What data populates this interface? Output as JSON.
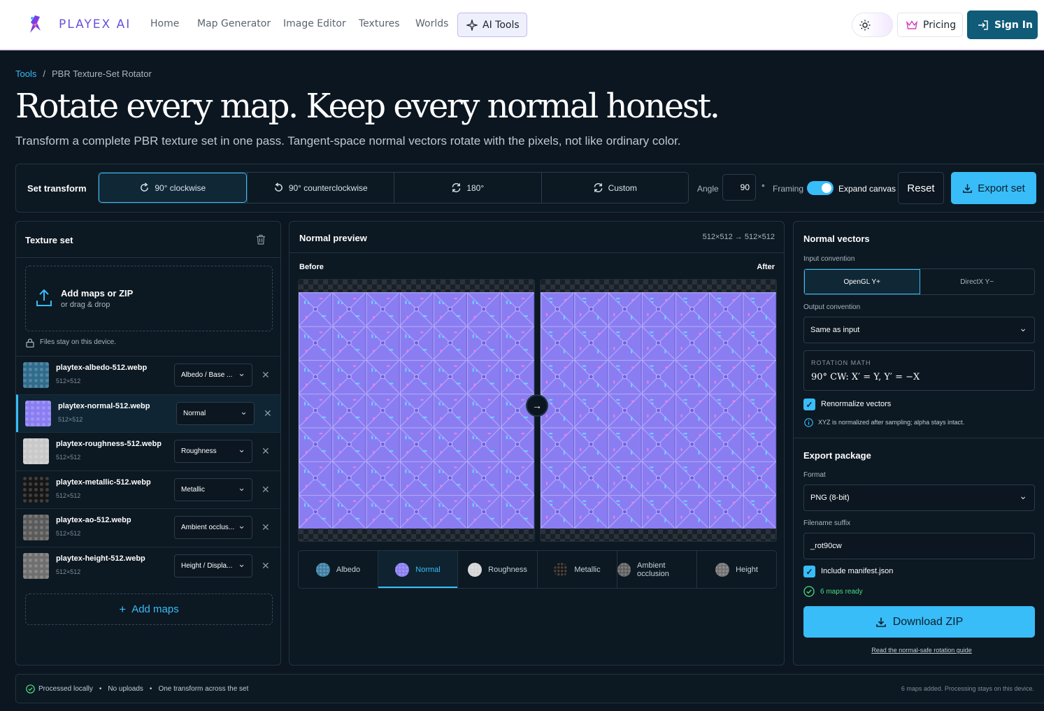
{
  "brand": {
    "name": "PLAYEX AI"
  },
  "nav": [
    "Home",
    "Map Generator",
    "Image Editor",
    "Textures",
    "Worlds"
  ],
  "header": {
    "ai_tools": "AI Tools",
    "pricing": "Pricing",
    "sign_in": "Sign In"
  },
  "breadcrumb": {
    "root": "Tools",
    "sep": "/",
    "current": "PBR Texture-Set Rotator"
  },
  "hero": {
    "title": "Rotate every map. Keep every normal honest.",
    "subtitle": "Transform a complete PBR texture set in one pass. Tangent-space normal vectors rotate with the pixels, not like ordinary color."
  },
  "toolbar": {
    "label": "Set transform",
    "options": [
      "90° clockwise",
      "90° counterclockwise",
      "180°",
      "Custom"
    ],
    "selected": "90° clockwise",
    "angle_label": "Angle",
    "angle_value": "90",
    "degree": "°",
    "framing_label": "Framing",
    "expand_label": "Expand canvas",
    "expand_on": true,
    "reset": "Reset",
    "export": "Export set"
  },
  "texture_set": {
    "title": "Texture set",
    "add_title": "Add maps or ZIP",
    "add_sub": "or drag & drop",
    "privacy": "Files stay on this device.",
    "add_more": "Add maps",
    "files": [
      {
        "name": "playtex-albedo-512.webp",
        "size": "512×512",
        "type": "Albedo / Base ...",
        "swatch": "#2f6b8c"
      },
      {
        "name": "playtex-normal-512.webp",
        "size": "512×512",
        "type": "Normal",
        "swatch": "#8a7df2"
      },
      {
        "name": "playtex-roughness-512.webp",
        "size": "512×512",
        "type": "Roughness",
        "swatch": "#c9c9c9"
      },
      {
        "name": "playtex-metallic-512.webp",
        "size": "512×512",
        "type": "Metallic",
        "swatch": "#151515"
      },
      {
        "name": "playtex-ao-512.webp",
        "size": "512×512",
        "type": "Ambient occlus...",
        "swatch": "#5a5a5a"
      },
      {
        "name": "playtex-height-512.webp",
        "size": "512×512",
        "type": "Height / Displa...",
        "swatch": "#6f6f6f"
      }
    ]
  },
  "preview": {
    "title": "Normal preview",
    "dims": "512×512 → 512×512",
    "before": "Before",
    "after": "After",
    "arrow": "→",
    "tabs": [
      {
        "label": "Albedo",
        "swatch": "#3c7ea3"
      },
      {
        "label": "Normal",
        "swatch": "#8a7df2"
      },
      {
        "label": "Roughness",
        "swatch": "#d4d4d4"
      },
      {
        "label": "Metallic",
        "swatch": "#161616"
      },
      {
        "label": "Ambient occlusion",
        "swatch": "#5e5e5e"
      },
      {
        "label": "Height",
        "swatch": "#707070"
      }
    ],
    "active_tab": "Normal"
  },
  "normals": {
    "title": "Normal vectors",
    "input_label": "Input convention",
    "input_options": [
      "OpenGL Y+",
      "DirectX Y−"
    ],
    "input_selected": "OpenGL Y+",
    "output_label": "Output convention",
    "output_value": "Same as input",
    "math_label": "ROTATION MATH",
    "math_value": "90° CW: X′ = Y, Y′ = −X",
    "renorm": "Renormalize vectors",
    "renorm_checked": true,
    "info": "XYZ is normalized after sampling; alpha stays intact."
  },
  "export_pkg": {
    "title": "Export package",
    "format_label": "Format",
    "format_value": "PNG (8-bit)",
    "suffix_label": "Filename suffix",
    "suffix_value": "_rot90cw",
    "manifest": "Include manifest.json",
    "manifest_checked": true,
    "ready": "6 maps ready",
    "download": "Download ZIP",
    "guide": "Read the normal-safe rotation guide"
  },
  "footer": {
    "items": [
      "Processed locally",
      "No uploads",
      "One transform across the set"
    ],
    "right": "6 maps added. Processing stays on this device."
  },
  "colors": {
    "accent": "#38bdf8",
    "background": "#0b1620",
    "brand": "#6b50d7",
    "normal_map": "#8a7df2"
  }
}
